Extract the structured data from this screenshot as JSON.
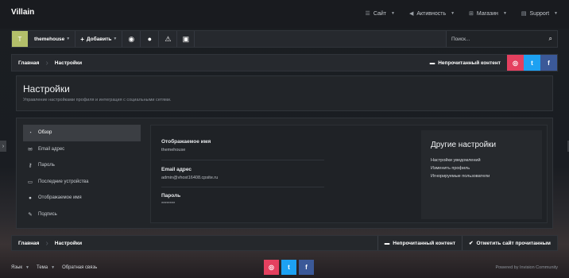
{
  "brand": "Villain",
  "topnav": [
    {
      "label": "Сайт",
      "icon": "list-icon"
    },
    {
      "label": "Активность",
      "icon": "megaphone-icon"
    },
    {
      "label": "Магазин",
      "icon": "cart-icon"
    },
    {
      "label": "Support",
      "icon": "document-icon"
    }
  ],
  "toolbar": {
    "avatar_letter": "T",
    "username": "themehouse",
    "add_label": "Добавить",
    "search_placeholder": "Поиск..."
  },
  "breadcrumb": {
    "items": [
      "Главная",
      "Настройки"
    ],
    "unread_label": "Непрочитанный контент"
  },
  "header": {
    "title": "Настройки",
    "description": "Управление настройками профиля и интеграция с социальными сетями."
  },
  "sidebar": {
    "items": [
      {
        "label": "Обзор",
        "icon": "dashboard-icon",
        "active": true
      },
      {
        "label": "Email адрес",
        "icon": "envelope-icon",
        "active": false
      },
      {
        "label": "Пароль",
        "icon": "key-icon",
        "active": false
      },
      {
        "label": "Последние устройства",
        "icon": "laptop-icon",
        "active": false
      },
      {
        "label": "Отображаемое имя",
        "icon": "user-icon",
        "active": false
      },
      {
        "label": "Подпись",
        "icon": "pencil-icon",
        "active": false
      }
    ]
  },
  "fields": [
    {
      "label": "Отображаемое имя",
      "value": "themehouse"
    },
    {
      "label": "Email адрес",
      "value": "admin@vhost16408.cpsite.ru"
    },
    {
      "label": "Пароль",
      "value": "********"
    }
  ],
  "other_settings": {
    "title": "Другие настройки",
    "links": [
      "Настройки уведомлений",
      "Изменить профиль",
      "Игнорируемые пользователи"
    ]
  },
  "bottombar": {
    "items": [
      "Главная",
      "Настройки"
    ],
    "unread_label": "Непрочитанный контент",
    "mark_read_label": "Отметить сайт прочитанным"
  },
  "footer": {
    "links": [
      "Язык",
      "Тема",
      "Обратная связь"
    ],
    "powered": "Powered by Invision Community"
  },
  "social": {
    "instagram": "◎",
    "twitter": "t",
    "facebook": "f"
  },
  "colors": {
    "instagram": "#e4405f",
    "twitter": "#1da1f2",
    "facebook": "#3b5998",
    "avatar": "#b3bf6a"
  }
}
